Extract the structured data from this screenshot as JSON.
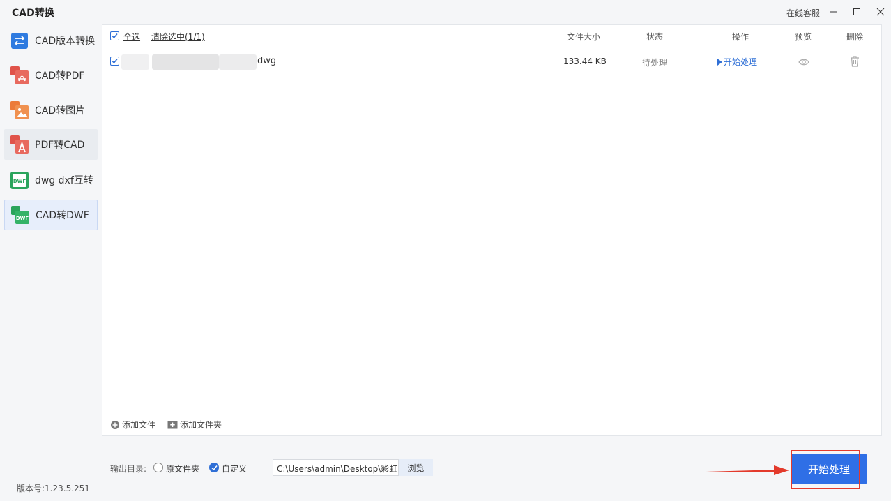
{
  "window": {
    "title": "CAD转换",
    "support_label": "在线客服"
  },
  "sidebar": {
    "items": [
      {
        "label": "CAD版本转换",
        "icon": "swap-arrows-icon",
        "color": "#2f7be0"
      },
      {
        "label": "CAD转PDF",
        "icon": "pdf-file-icon",
        "color": "#e0534a"
      },
      {
        "label": "CAD转图片",
        "icon": "image-file-icon",
        "color": "#ec7b3a"
      },
      {
        "label": "PDF转CAD",
        "icon": "pdf-to-cad-icon",
        "color": "#e0534a"
      },
      {
        "label": "dwg dxf互转",
        "icon": "dwg-file-icon",
        "color": "#2aa45c"
      },
      {
        "label": "CAD转DWF",
        "icon": "dwf-file-icon",
        "color": "#2aa45c"
      }
    ],
    "active_item": "CAD转DWF"
  },
  "file_table": {
    "select_all_label": "全选",
    "clear_selection_label": "清除选中(1/1)",
    "columns": {
      "size": "文件大小",
      "status": "状态",
      "action": "操作",
      "preview": "预览",
      "delete": "删除"
    },
    "rows": [
      {
        "checked": true,
        "name_suffix": "dwg",
        "size": "133.44 KB",
        "status": "待处理",
        "action": "开始处理"
      }
    ]
  },
  "add_file_label": "添加文件",
  "add_folder_label": "添加文件夹",
  "output": {
    "label": "输出目录:",
    "option_original": "原文件夹",
    "option_custom": "自定义",
    "selected": "自定义",
    "path": "C:\\Users\\admin\\Desktop\\彩虹",
    "browse_label": "浏览"
  },
  "start_button_label": "开始处理",
  "version_label": "版本号:1.23.5.251",
  "colors": {
    "accent": "#2f6fe6",
    "highlight": "#e33a2c"
  }
}
